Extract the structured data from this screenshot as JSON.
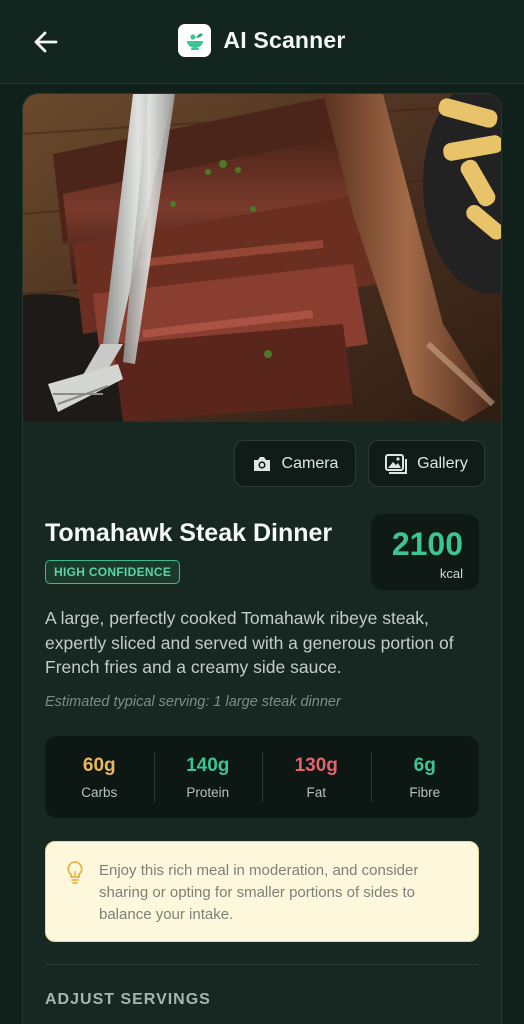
{
  "header": {
    "title": "AI Scanner",
    "back_icon": "arrow-left-icon",
    "logo_icon": "salad-bowl-icon"
  },
  "photo": {
    "subject": "tomahawk-steak-photo"
  },
  "image_source": {
    "camera_label": "Camera",
    "camera_icon": "camera-icon",
    "gallery_label": "Gallery",
    "gallery_icon": "gallery-icon"
  },
  "result": {
    "name": "Tomahawk Steak Dinner",
    "confidence": "HIGH CONFIDENCE",
    "calories": "2100",
    "calories_unit": "kcal",
    "description": "A large, perfectly cooked Tomahawk ribeye steak, expertly sliced and served with a generous portion of French fries and a creamy side sauce.",
    "serving": "Estimated typical serving: 1 large steak dinner"
  },
  "macros": [
    {
      "value": "60g",
      "label": "Carbs",
      "color": "#eab85e"
    },
    {
      "value": "140g",
      "label": "Protein",
      "color": "#3cc592"
    },
    {
      "value": "130g",
      "label": "Fat",
      "color": "#e2646c"
    },
    {
      "value": "6g",
      "label": "Fibre",
      "color": "#3cc592"
    }
  ],
  "tip": {
    "icon": "lightbulb-icon",
    "text": "Enjoy this rich meal in moderation, and consider sharing or opting for smaller portions of sides to balance your intake."
  },
  "adjust": {
    "title": "ADJUST SERVINGS"
  },
  "colors": {
    "accent": "#3cc592",
    "background": "#10201b",
    "card": "#172822"
  }
}
